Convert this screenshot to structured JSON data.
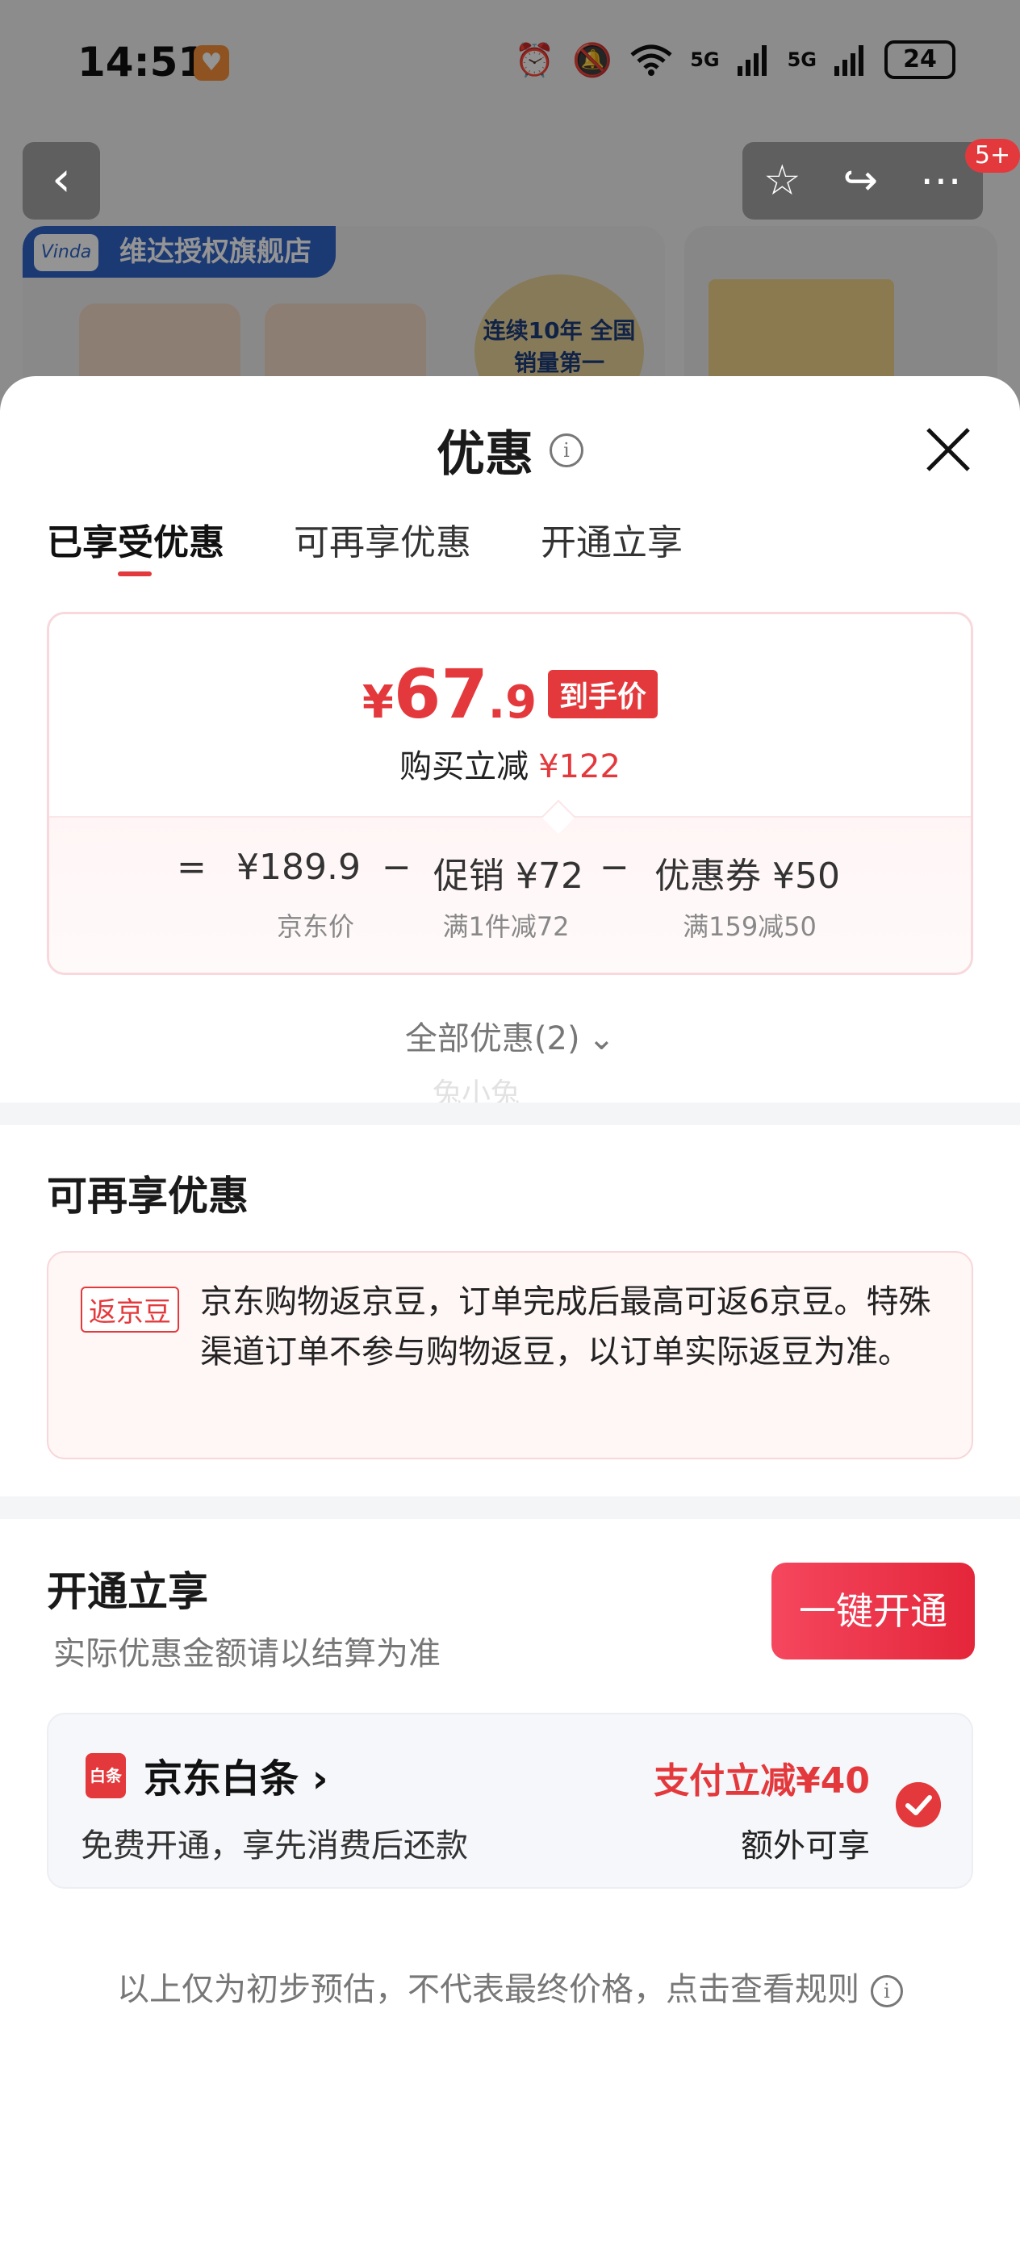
{
  "status_bar": {
    "time": "14:51",
    "battery": "24",
    "network_1": "5G",
    "network_2": "5G"
  },
  "background": {
    "store_name": "维达授权旗舰店",
    "store_logo": "Vinda",
    "sales_badge": "连续10年 全国 销量第一",
    "notification_count": "5+"
  },
  "sheet": {
    "title": "优惠",
    "tabs": [
      "已享受优惠",
      "可再享优惠",
      "开通立享"
    ],
    "active_tab": 0
  },
  "final_price": {
    "currency": "¥",
    "integer": "67",
    "decimal": ".9",
    "tag": "到手价",
    "save_label": "购买立减",
    "save_amount": "¥122"
  },
  "breakdown": {
    "equals": "=",
    "minus": "−",
    "items": [
      {
        "value": "¥189.9",
        "label": "京东价"
      },
      {
        "value": "促销 ¥72",
        "label": "满1件减72"
      },
      {
        "value": "优惠券 ¥50",
        "label": "满159减50"
      }
    ]
  },
  "all_offers": "全部优惠(2)",
  "watermark": "兔小兔",
  "extra_offers": {
    "title": "可再享优惠",
    "tag": "返京豆",
    "text": "京东购物返京豆，订单完成后最高可返6京豆。特殊渠道订单不参与购物返豆，以订单实际返豆为准。"
  },
  "open_now": {
    "title": "开通立享",
    "subtitle": "实际优惠金额请以结算为准",
    "button": "一键开通",
    "card": {
      "icon_text": "白条",
      "name": "京东白条",
      "desc": "免费开通，享先消费后还款",
      "discount": "支付立减¥40",
      "extra": "额外可享"
    }
  },
  "footnote": "以上仅为初步预估，不代表最终价格，点击查看规则",
  "colors": {
    "accent": "#e4393c",
    "muted": "#777777",
    "card_border": "#f8d8dc"
  }
}
